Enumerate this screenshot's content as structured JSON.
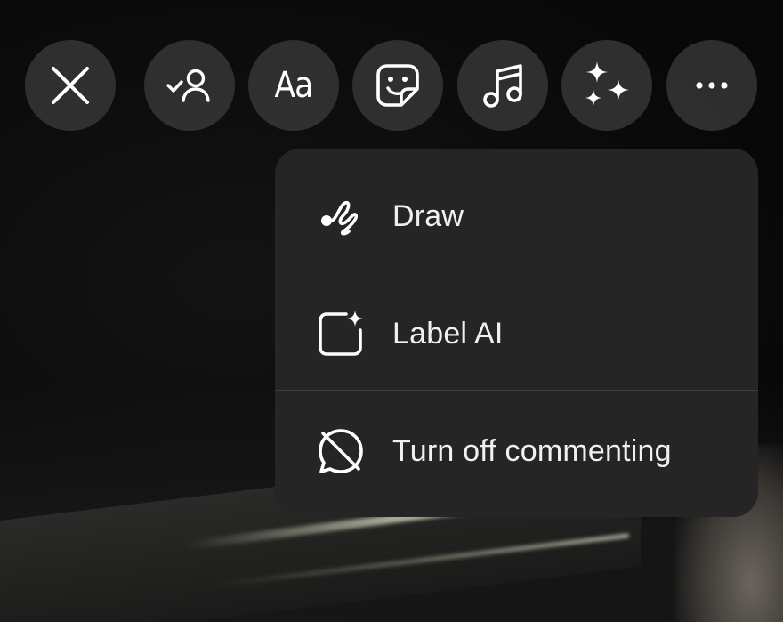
{
  "toolbar": {
    "buttons": [
      {
        "name": "close",
        "icon": "close-icon"
      },
      {
        "name": "tag-people",
        "icon": "tag-person-icon"
      },
      {
        "name": "text",
        "icon": "text-icon",
        "label": "Aa"
      },
      {
        "name": "sticker",
        "icon": "sticker-icon"
      },
      {
        "name": "music",
        "icon": "music-note-icon"
      },
      {
        "name": "effects",
        "icon": "sparkles-icon"
      },
      {
        "name": "more",
        "icon": "more-horizontal-icon"
      }
    ]
  },
  "menu": {
    "items": [
      {
        "label": "Draw",
        "icon": "draw-squiggle-icon"
      },
      {
        "label": "Label AI",
        "icon": "label-ai-icon"
      },
      {
        "label": "Turn off commenting",
        "icon": "comment-off-icon"
      }
    ]
  },
  "colors": {
    "background": "#0b0b0b",
    "toolbar_button": "#3a3a3a",
    "menu_background": "#252525",
    "divider": "#3d3d3d",
    "text": "#f0f0f0"
  }
}
